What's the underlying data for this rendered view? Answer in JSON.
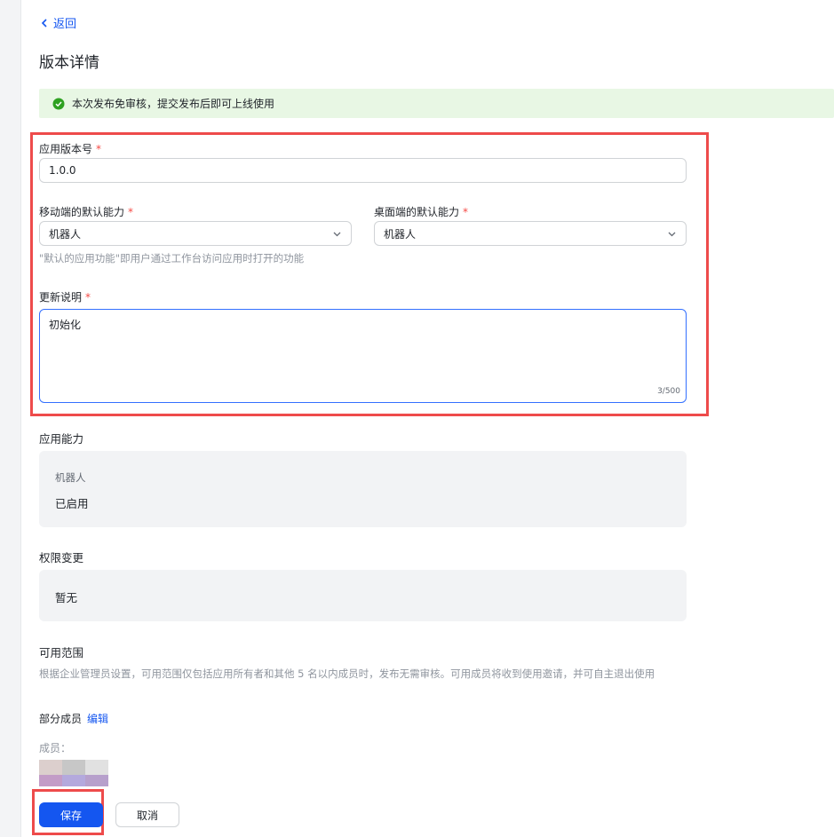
{
  "nav": {
    "back_label": "返回"
  },
  "page": {
    "title": "版本详情"
  },
  "banner": {
    "text": "本次发布免审核，提交发布后即可上线使用",
    "icon": "check-circle-icon",
    "color": "#2ea121"
  },
  "form": {
    "version": {
      "label": "应用版本号",
      "required_mark": "*",
      "value": "1.0.0"
    },
    "mobile_default": {
      "label": "移动端的默认能力",
      "required_mark": "*",
      "value": "机器人"
    },
    "desktop_default": {
      "label": "桌面端的默认能力",
      "required_mark": "*",
      "value": "机器人"
    },
    "default_help": "\"默认的应用功能\"即用户通过工作台访问应用时打开的功能",
    "release_notes": {
      "label": "更新说明",
      "required_mark": "*",
      "value": "初始化",
      "counter": "3/500"
    }
  },
  "capabilities": {
    "title": "应用能力",
    "name": "机器人",
    "status": "已启用"
  },
  "permissions": {
    "title": "权限变更",
    "value": "暂无"
  },
  "scope": {
    "title": "可用范围",
    "description": "根据企业管理员设置，可用范围仅包括应用所有者和其他 5 名以内成员时，发布无需审核。可用成员将收到使用邀请，并可自主退出使用",
    "members_type": "部分成员",
    "edit_label": "编辑",
    "members_label": "成员："
  },
  "actions": {
    "save_label": "保存",
    "cancel_label": "取消"
  },
  "colors": {
    "accent": "#1456f0",
    "required": "#f54a45",
    "highlight_frame": "#ee4b4b",
    "banner_bg": "#e8f7e4"
  }
}
